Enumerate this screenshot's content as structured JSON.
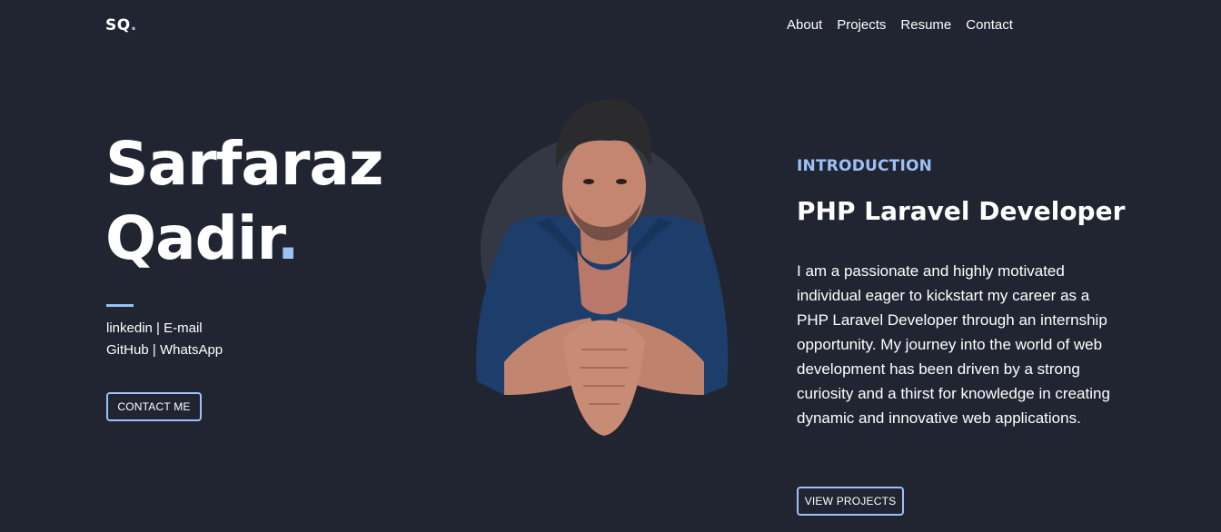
{
  "header": {
    "logo_text": "SQ",
    "logo_dot": ".",
    "nav": [
      "About",
      "Projects",
      "Resume",
      "Contact"
    ]
  },
  "hero": {
    "first_name": "Sarfaraz",
    "last_name": "Qadir",
    "name_dot": ".",
    "links": {
      "linkedin": "linkedin",
      "email": "E-mail",
      "github": "GitHub",
      "whatsapp": "WhatsApp",
      "separator": "|"
    },
    "contact_button": "CONTACT ME"
  },
  "intro": {
    "label": "INTRODUCTION",
    "role": "PHP Laravel Developer",
    "bio": "I am a passionate and highly motivated individual eager to kickstart my career as a PHP Laravel Developer through an internship opportunity. My journey into the world of web development has been driven by a strong curiosity and a thirst for knowledge in creating dynamic and innovative web applications.",
    "projects_button": "VIEW PROJECTS"
  },
  "colors": {
    "background": "#212531",
    "accent": "#9cc0f7",
    "text": "#ffffff"
  }
}
